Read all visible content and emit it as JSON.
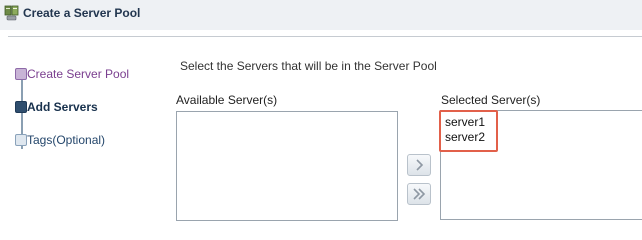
{
  "header": {
    "title": "Create a Server Pool",
    "icon": "server-pool-icon"
  },
  "train": {
    "steps": [
      {
        "label": "Create Server Pool",
        "state": "visited"
      },
      {
        "label": "Add Servers",
        "state": "current"
      },
      {
        "label": "Tags(Optional)",
        "state": "unvisited"
      }
    ]
  },
  "main": {
    "instruction": "Select the Servers that will be in the Server Pool",
    "available": {
      "label": "Available Server(s)",
      "items": []
    },
    "selected": {
      "label": "Selected Server(s)",
      "items": [
        "server1",
        "server2"
      ]
    }
  },
  "shuttle": {
    "move_icon": "chevron-right-icon",
    "move_all_icon": "double-chevron-right-icon"
  },
  "colors": {
    "highlight": "#e2604a",
    "current_step": "#2f4e6e",
    "visited_step": "#7a3e8f"
  }
}
